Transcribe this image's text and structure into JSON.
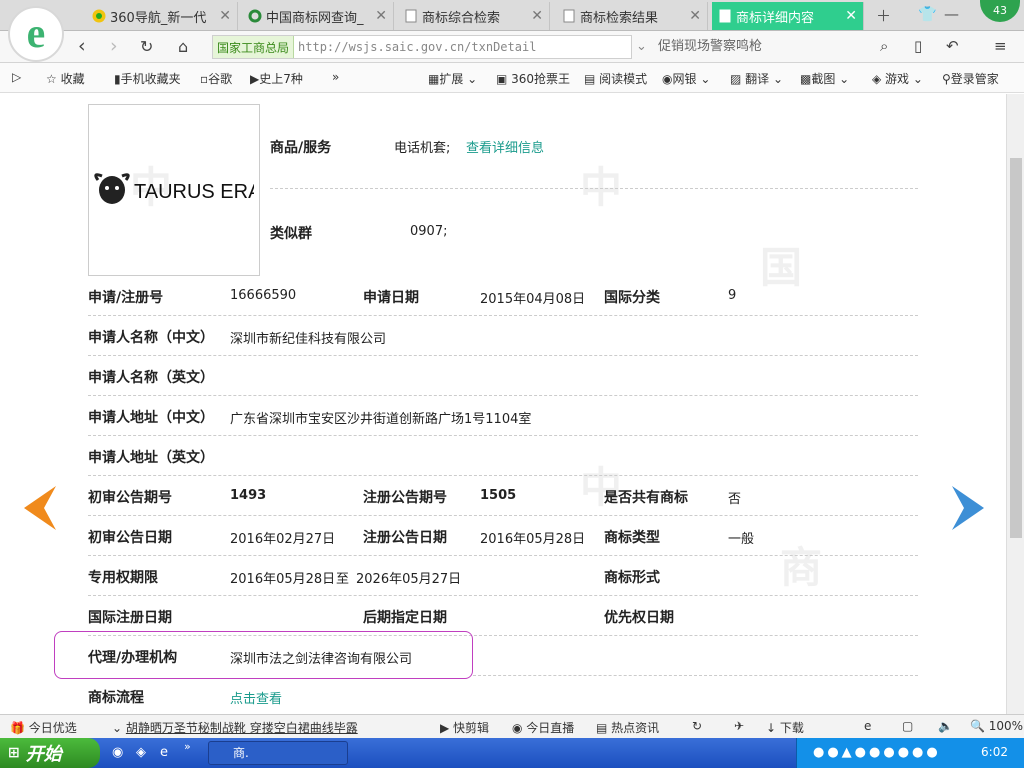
{
  "browser": {
    "tabs": [
      {
        "label": "360导航_新一代",
        "active": false
      },
      {
        "label": "中国商标网查询_",
        "active": false
      },
      {
        "label": "商标综合检索",
        "active": false
      },
      {
        "label": "商标检索结果",
        "active": false
      },
      {
        "label": "商标详细内容",
        "active": true
      }
    ],
    "badge": "43",
    "site_label": "国家工商总局",
    "url": "http://wsjs.saic.gov.cn/txnDetail",
    "search_hint": "促销现场警察鸣枪",
    "bookmarks": [
      "收藏",
      "手机收藏夹",
      "谷歌",
      "史上7种",
      "扩展",
      "360抢票王",
      "阅读模式",
      "网银",
      "翻译",
      "截图",
      "游戏",
      "登录管家"
    ]
  },
  "trademark": {
    "logo_text": "TAURUS ERA",
    "goods_label": "商品/服务",
    "goods_value": "电话机套;",
    "goods_link": "查看详细信息",
    "similar_label": "类似群",
    "similar_value": "0907;",
    "reg_no_label": "申请/注册号",
    "reg_no": "16666590",
    "apply_date_label": "申请日期",
    "apply_date": "2015年04月08日",
    "intl_class_label": "国际分类",
    "intl_class": "9",
    "applicant_cn_label": "申请人名称（中文）",
    "applicant_cn": "深圳市新纪佳科技有限公司",
    "applicant_en_label": "申请人名称（英文）",
    "applicant_en": "",
    "address_cn_label": "申请人地址（中文）",
    "address_cn": "广东省深圳市宝安区沙井街道创新路广场1号1104室",
    "address_en_label": "申请人地址（英文）",
    "address_en": "",
    "prelim_no_label": "初审公告期号",
    "prelim_no": "1493",
    "reg_pub_no_label": "注册公告期号",
    "reg_pub_no": "1505",
    "shared_label": "是否共有商标",
    "shared": "否",
    "prelim_date_label": "初审公告日期",
    "prelim_date": "2016年02月27日",
    "reg_pub_date_label": "注册公告日期",
    "reg_pub_date": "2016年05月28日",
    "tm_type_label": "商标类型",
    "tm_type": "一般",
    "valid_label": "专用权期限",
    "valid_from": "2016年05月28日",
    "valid_sep": "至",
    "valid_to": "2026年05月27日",
    "tm_form_label": "商标形式",
    "intl_reg_date_label": "国际注册日期",
    "later_date_label": "后期指定日期",
    "priority_label": "优先权日期",
    "agent_label": "代理/办理机构",
    "agent": "深圳市法之剑法律咨询有限公司",
    "process_label": "商标流程",
    "process_link": "点击查看"
  },
  "status": {
    "items": [
      "今日优选",
      "胡静晒万圣节秘制战靴 穿搂空白裙曲线毕露",
      "快剪辑",
      "今日直播",
      "热点资讯",
      "下载"
    ],
    "zoom": "100%"
  },
  "taskbar": {
    "start": "开始",
    "task": "商.",
    "clock": "6:02"
  }
}
